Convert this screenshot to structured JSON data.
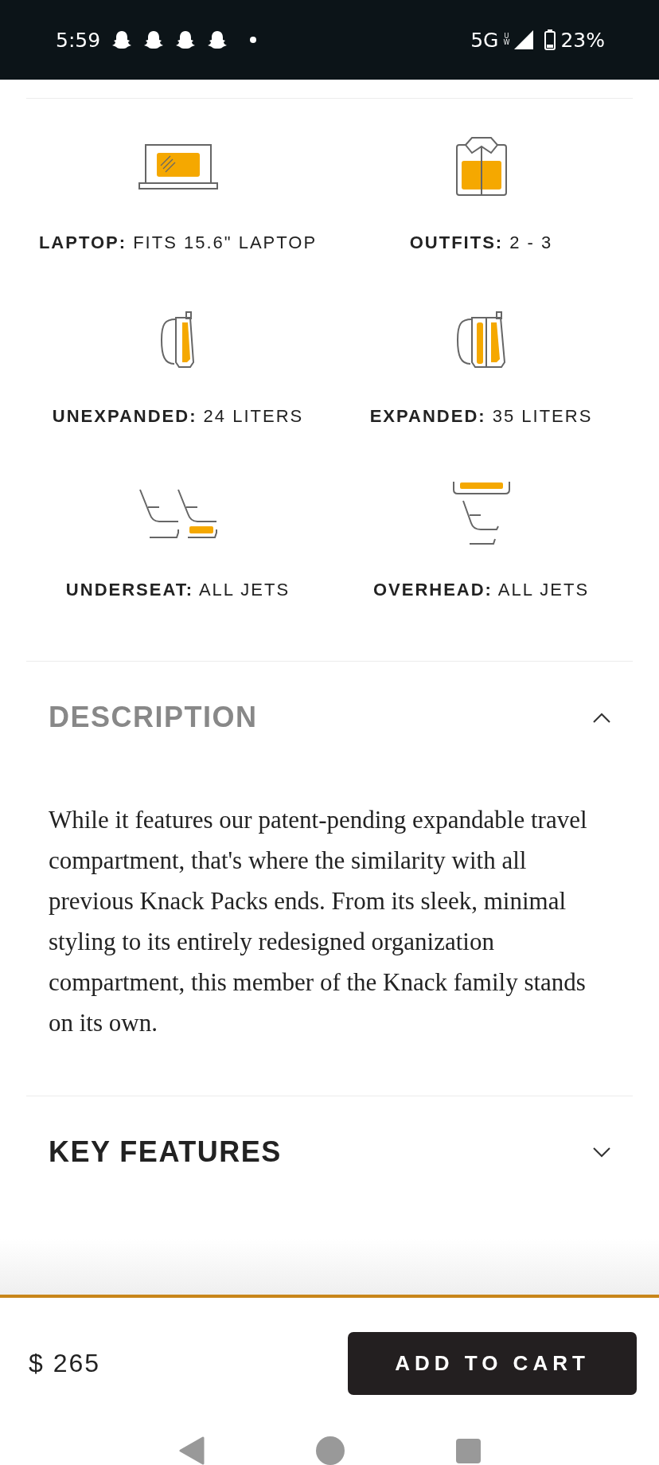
{
  "status_bar": {
    "time": "5:59",
    "notifications": [
      {
        "kind": "ghost"
      },
      {
        "kind": "ghost"
      },
      {
        "kind": "ghost"
      },
      {
        "kind": "ghost"
      }
    ],
    "network": "5G",
    "network_sub": "UW",
    "battery": "23%"
  },
  "specs": [
    {
      "kind": "laptop",
      "text": "**LAPTOP:** FITS 15.6\" LAPTOP"
    },
    {
      "kind": "shirt",
      "text": "**OUTFITS:** 2 - 3"
    },
    {
      "kind": "backpack",
      "text": "**UNEXPANDED:** 24 LITERS"
    },
    {
      "kind": "backpack-expanded",
      "text": "**EXPANDED:** 35 LITERS"
    },
    {
      "kind": "underseat",
      "text": "**UNDERSEAT:** ALL JETS"
    },
    {
      "kind": "overhead",
      "text": "**OVERHEAD:** ALL JETS"
    }
  ],
  "sections": [
    {
      "title": "DESCRIPTION",
      "expanded": true,
      "body": "While it features our patent-pending expandable travel compartment, that's where the similarity with all previous Knack Packs ends. From its sleek, minimal styling to its entirely redesigned organization compartment, this member of the Knack family stands on its own."
    },
    {
      "title": "KEY FEATURES",
      "expanded": false
    }
  ],
  "bottom_bar": {
    "price": "$ 265",
    "button": "ADD TO CART"
  }
}
